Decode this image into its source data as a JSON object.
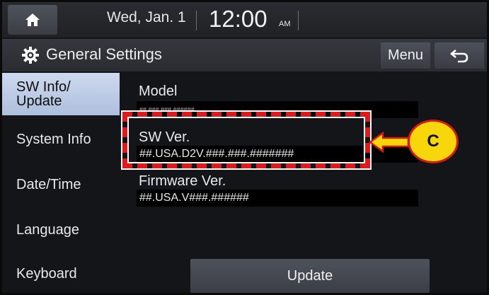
{
  "status_bar": {
    "date": "Wed, Jan. 1",
    "time": "12:00",
    "ampm": "AM",
    "home_icon": "home-icon"
  },
  "title_bar": {
    "title": "General Settings",
    "menu_label": "Menu",
    "settings_icon": "gear-icon",
    "back_icon": "back-arrow-icon"
  },
  "sidebar": {
    "items": [
      {
        "label_line1": "SW Info/",
        "label_line2": "Update",
        "active": true
      },
      {
        "label": "System Info"
      },
      {
        "label": "Date/Time"
      },
      {
        "label": "Language"
      },
      {
        "label": "Keyboard"
      }
    ]
  },
  "content": {
    "model_label": "Model",
    "model_value": "##.###.###.######",
    "sw_label": "SW Ver.",
    "sw_value": "##.USA.D2V.###.###.#######",
    "fw_label": "Firmware Ver.",
    "fw_value": "##.USA.V###.######",
    "update_label": "Update"
  },
  "annotation": {
    "callout_letter": "C",
    "colors": {
      "highlight": "#e01a1a",
      "callout_fill": "#f7d70b"
    }
  }
}
